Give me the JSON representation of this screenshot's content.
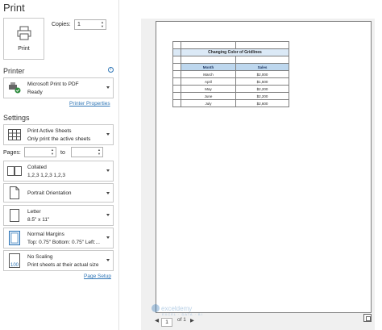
{
  "page_title": "Print",
  "print_button": {
    "label": "Print",
    "icon": "printer-icon"
  },
  "copies": {
    "label": "Copies:",
    "value": "1"
  },
  "printer": {
    "heading": "Printer",
    "name": "Microsoft Print to PDF",
    "status": "Ready",
    "properties_link": "Printer Properties"
  },
  "settings": {
    "heading": "Settings",
    "print_what": {
      "line1": "Print Active Sheets",
      "line2": "Only print the active sheets"
    },
    "pages": {
      "label": "Pages:",
      "to_label": "to",
      "from": "",
      "to": ""
    },
    "collation": {
      "line1": "Collated",
      "line2": "1,2,3    1,2,3    1,2,3"
    },
    "orientation": {
      "line1": "Portrait Orientation"
    },
    "paper": {
      "line1": "Letter",
      "line2": "8.5\" x 11\""
    },
    "margins": {
      "line1": "Normal Margins",
      "line2": "Top: 0.75\" Bottom: 0.75\" Left:..."
    },
    "scaling": {
      "line1": "No Scaling",
      "line2": "Print sheets at their actual size"
    },
    "page_setup_link": "Page Setup"
  },
  "preview": {
    "sheet_title": "Changing Color of Gridlines",
    "headers": [
      "Month",
      "Sales"
    ],
    "rows": [
      [
        "March",
        "$2,000"
      ],
      [
        "April",
        "$1,500"
      ],
      [
        "May",
        "$2,200"
      ],
      [
        "June",
        "$2,200"
      ],
      [
        "July",
        "$2,600"
      ]
    ],
    "gridline_color": "#7f7f7f",
    "header_fill": "#bdd7ee"
  },
  "page_nav": {
    "current": "1",
    "of_label": "of 1"
  },
  "watermark": {
    "name": "exceldemy",
    "tagline": "EXCEL · DATA · BI"
  }
}
